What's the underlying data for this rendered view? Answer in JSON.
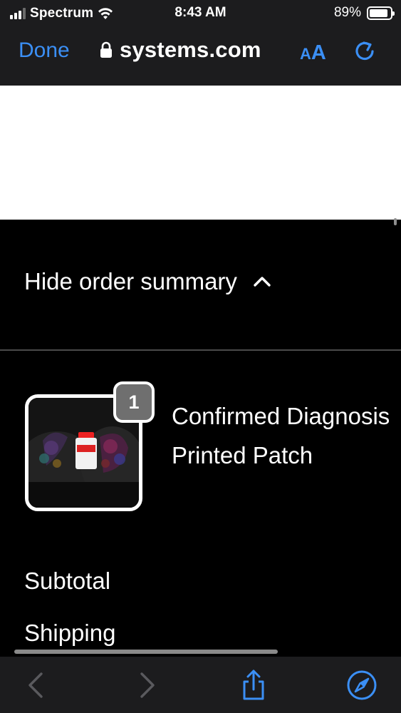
{
  "status_bar": {
    "carrier": "Spectrum",
    "time": "8:43 AM",
    "battery_percent": "89%",
    "battery_level": 0.89,
    "signal_bars": 4,
    "signal_bars_active": 3
  },
  "browser_bar": {
    "done_label": "Done",
    "url": "systems.com",
    "aa_small": "A",
    "aa_large": "A",
    "accent_color": "#3b8ff5"
  },
  "order_summary": {
    "toggle_label": "Hide order summary",
    "toggle_icon": "chevron-up-icon",
    "product": {
      "quantity": "1",
      "name": "Confirmed Diagnosis Printed Patch"
    },
    "subtotal_label": "Subtotal",
    "shipping_label": "Shipping"
  },
  "toolbar": {
    "icons": [
      "chevron-left-icon",
      "chevron-right-icon",
      "share-icon",
      "compass-icon"
    ],
    "back_enabled": false,
    "forward_enabled": false
  }
}
